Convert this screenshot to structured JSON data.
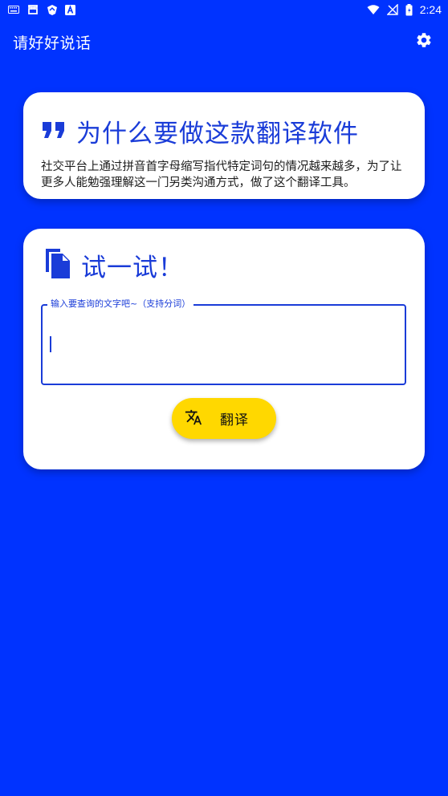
{
  "status_bar": {
    "time": "2:24",
    "left_icons": [
      "keyboard-icon",
      "app-notification-icon",
      "shield-icon",
      "a-icon"
    ],
    "right_icons": [
      "wifi-icon",
      "no-signal-icon",
      "battery-icon"
    ]
  },
  "app_bar": {
    "title": "请好好说话",
    "settings_icon": "gear-icon"
  },
  "why_card": {
    "icon": "quote-icon",
    "title": "为什么要做这款翻译软件",
    "body": "社交平台上通过拼音首字母缩写指代特定词句的情况越来越多，为了让更多人能勉强理解这一门另类沟通方式，做了这个翻译工具。"
  },
  "try_card": {
    "icon": "copy-icon",
    "title": "试一试！",
    "input_label": "输入要查询的文字吧~（支持分词）",
    "input_value": "",
    "translate_icon": "translate-icon",
    "translate_label": "翻译"
  },
  "colors": {
    "background": "#0033ff",
    "accent": "#1a3cd8",
    "button": "#ffd800"
  }
}
